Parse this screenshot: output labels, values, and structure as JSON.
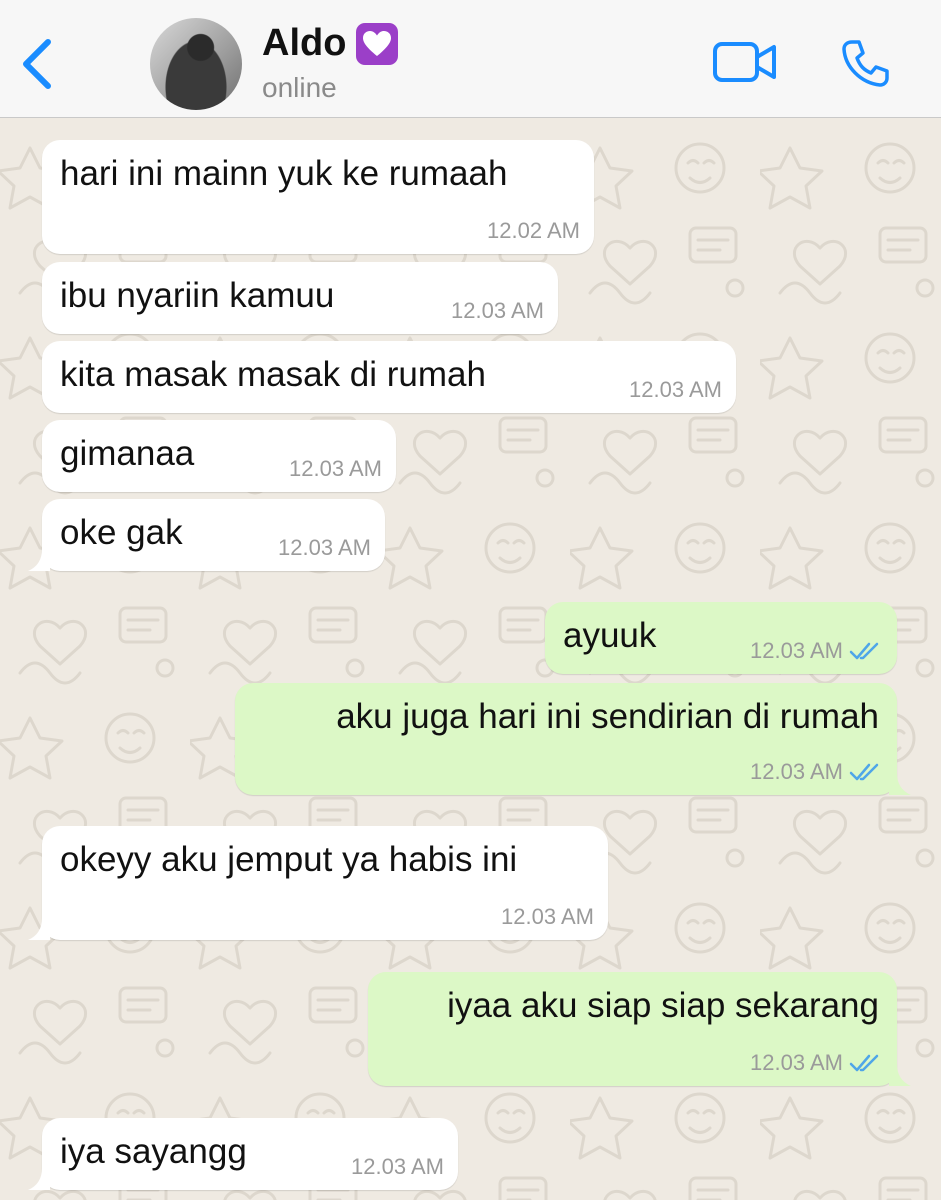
{
  "header": {
    "contact_name": "Aldo",
    "contact_status": "online",
    "badge_icon": "purple-heart-icon",
    "icons": [
      "back-chevron-icon",
      "video-camera-icon",
      "phone-icon"
    ],
    "accent_color": "#1a8cff"
  },
  "messages": [
    {
      "direction": "incoming",
      "text": "hari ini mainn yuk ke rumaah",
      "time": "12.02 AM"
    },
    {
      "direction": "incoming",
      "text": "ibu nyariin kamuu",
      "time": "12.03 AM"
    },
    {
      "direction": "incoming",
      "text": "kita masak masak di rumah",
      "time": "12.03 AM"
    },
    {
      "direction": "incoming",
      "text": "gimanaa",
      "time": "12.03 AM"
    },
    {
      "direction": "incoming",
      "text": "oke gak",
      "time": "12.03 AM"
    },
    {
      "direction": "outgoing",
      "text": "ayuuk",
      "time": "12.03 AM",
      "status": "read"
    },
    {
      "direction": "outgoing",
      "text": "aku juga hari ini sendirian di rumah",
      "time": "12.03 AM",
      "status": "read"
    },
    {
      "direction": "incoming",
      "text": "okeyy aku jemput ya habis ini",
      "time": "12.03 AM"
    },
    {
      "direction": "outgoing",
      "text": "iyaa aku siap siap sekarang",
      "time": "12.03 AM",
      "status": "read"
    },
    {
      "direction": "incoming",
      "text": "iya sayangg",
      "time": "12.03 AM"
    }
  ],
  "colors": {
    "incoming_bubble": "#ffffff",
    "outgoing_bubble": "#dcf8c6",
    "read_ticks": "#4fa6e8",
    "chat_background": "#efeae2"
  }
}
